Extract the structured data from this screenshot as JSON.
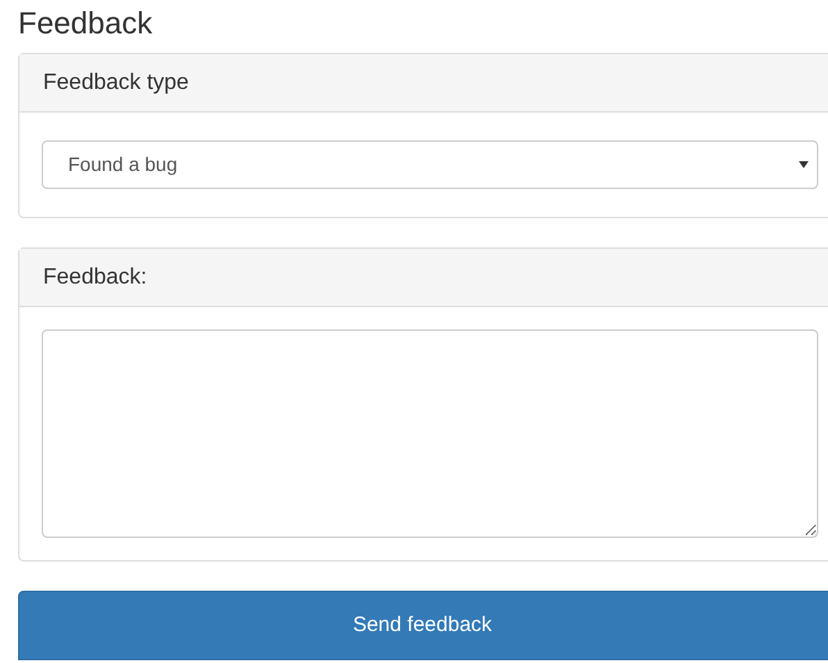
{
  "title": "Feedback",
  "panels": [
    {
      "kind": "select",
      "heading": "Feedback type",
      "value": "Found a bug"
    },
    {
      "kind": "textarea",
      "heading": "Feedback:"
    }
  ],
  "button": "Send feedback"
}
